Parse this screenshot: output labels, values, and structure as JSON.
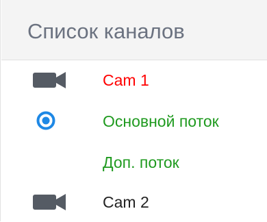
{
  "header": {
    "title": "Список каналов"
  },
  "channels": [
    {
      "label": "Cam 1",
      "icon": "camera-icon",
      "state": "active"
    },
    {
      "label": "Основной поток",
      "icon": "radio-selected-icon"
    },
    {
      "label": "Доп. поток"
    },
    {
      "label": "Cam 2",
      "icon": "camera-icon"
    }
  ],
  "colors": {
    "active_channel": "#ff0000",
    "stream": "#1f9a1f",
    "radio": "#1e88e5",
    "camera_icon": "#555b64"
  }
}
